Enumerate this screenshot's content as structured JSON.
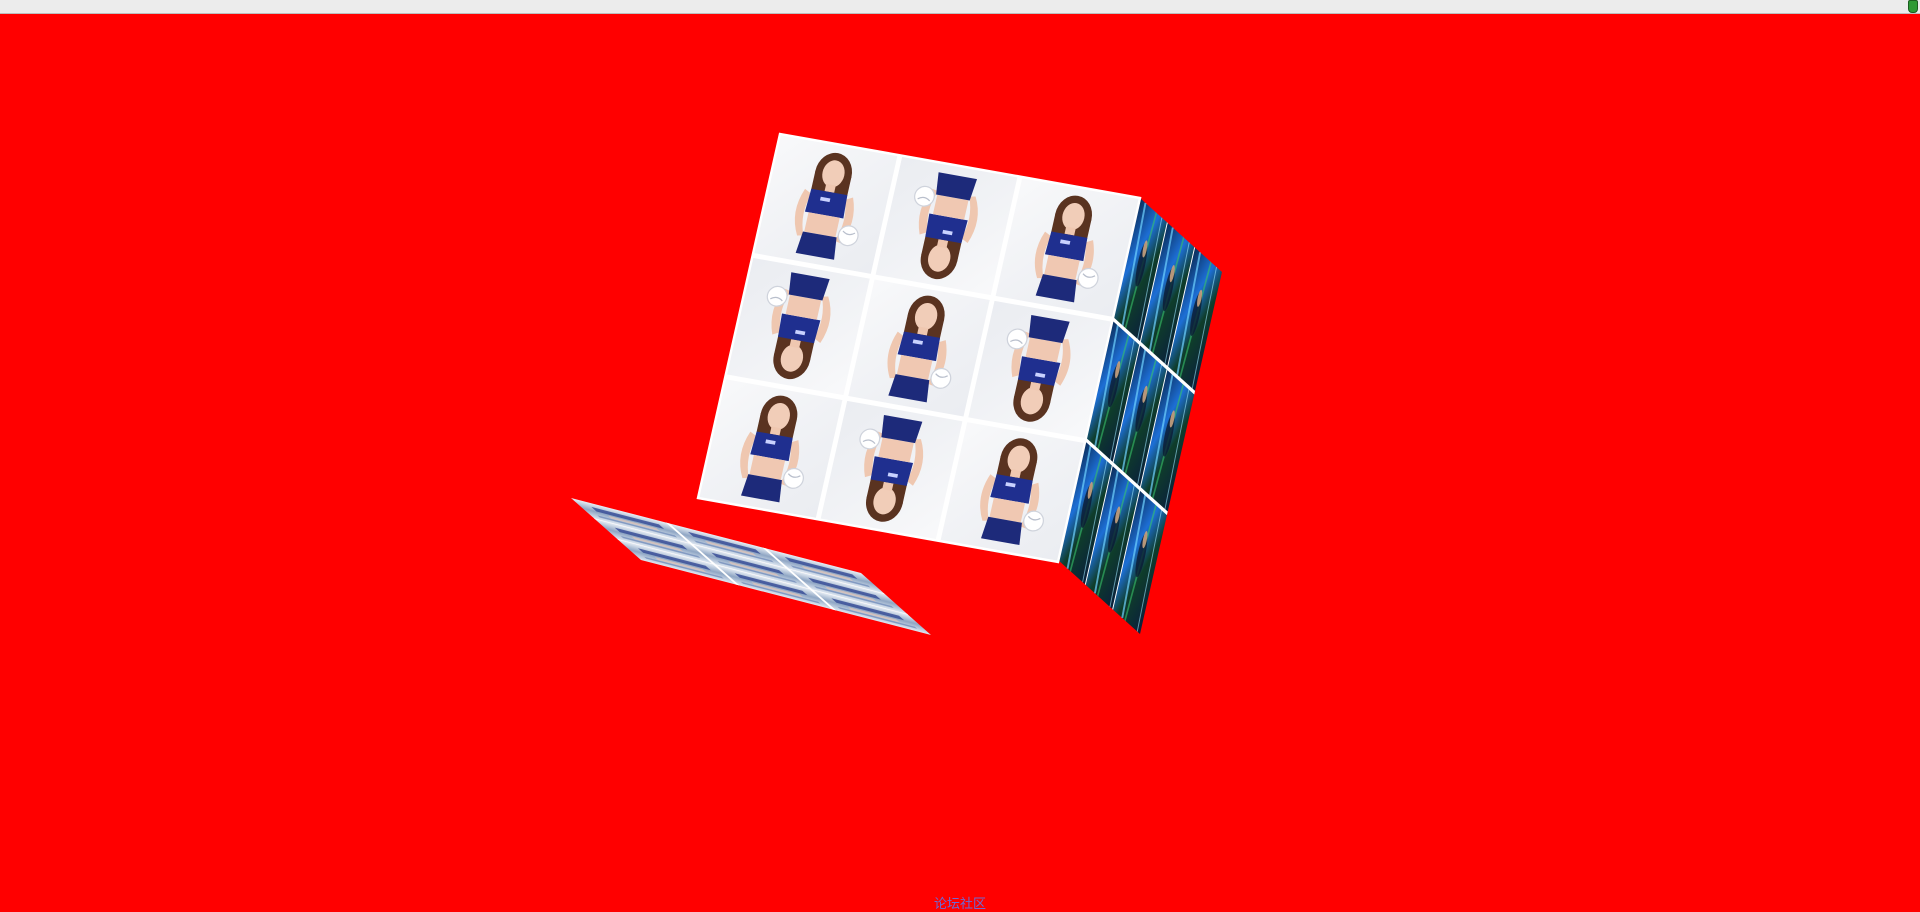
{
  "page": {
    "background": "#ff0000"
  },
  "top_strip": {
    "corner_icon": "battery-icon",
    "corner_icon_color": "#2e9a35"
  },
  "cube": {
    "grid": "3x3",
    "front_face": {
      "image": "photo-woman-blue-top-white-bg",
      "tile_orientation": [
        [
          "upright",
          "inverted",
          "upright"
        ],
        [
          "inverted",
          "upright",
          "inverted"
        ],
        [
          "upright",
          "inverted",
          "upright"
        ]
      ]
    },
    "right_face": {
      "image": "photo-blue-green-neon"
    },
    "bottom_face": {
      "image": "photo-light-blue-reflection"
    }
  },
  "footer": {
    "link_text": "论坛社区"
  }
}
